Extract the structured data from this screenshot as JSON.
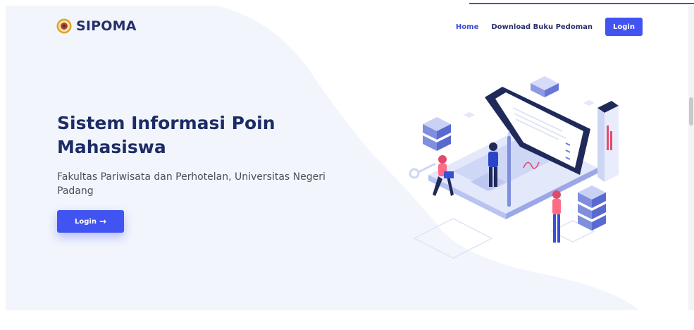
{
  "brand": {
    "name": "SIPOMA"
  },
  "nav": {
    "home": "Home",
    "download": "Download Buku Pedoman",
    "login": "Login"
  },
  "hero": {
    "title": "Sistem Informasi Poin Mahasiswa",
    "subtitle": "Fakultas Pariwisata dan Perhotelan, Universitas Negeri Padang",
    "button_label": "Login",
    "button_icon": "arrow-right-icon"
  },
  "colors": {
    "accent": "#4154f1",
    "title": "#1d2c66",
    "background_shape": "#f2f5fc"
  },
  "icons": {
    "logo": "university-seal-logo"
  }
}
